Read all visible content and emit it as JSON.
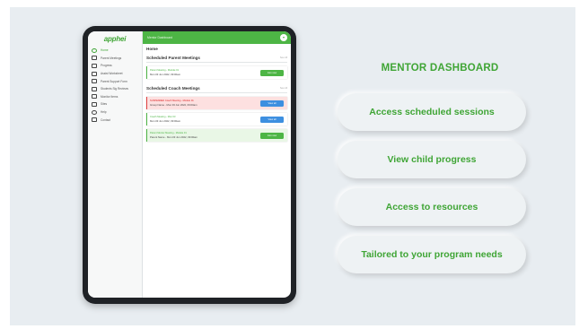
{
  "logo": "apphei",
  "sidebar": {
    "items": [
      {
        "label": "Home",
        "active": true
      },
      {
        "label": "Parent Meetings"
      },
      {
        "label": "Progress"
      },
      {
        "label": "Assist Worksheet"
      },
      {
        "label": "Parent Support Form"
      },
      {
        "label": "Students Sig Reviews"
      },
      {
        "label": "Monitor Items"
      },
      {
        "label": "Sites"
      },
      {
        "label": "Help"
      },
      {
        "label": "Contact"
      }
    ]
  },
  "topbar": {
    "label": "Mentor Dashboard",
    "menu_icon": "chevron-down-icon"
  },
  "main": {
    "title": "Home",
    "parent_section": {
      "title": "Scheduled Parent Meetings",
      "see_all": "See All",
      "cards": [
        {
          "line1": "Parent Meeting - Module 01",
          "line2": "Mon 03 Jun 2022, 09:00am",
          "button": "Join now",
          "button_color": "green",
          "style": "plain"
        }
      ]
    },
    "coach_section": {
      "title": "Scheduled Coach Meetings",
      "see_all": "See All",
      "cards": [
        {
          "line1": "SUSPENDED Coach Meeting - Module 01",
          "line2": "Group Name - Mon 03 Jun 2022, 09:00am",
          "button": "View all",
          "button_color": "blue",
          "style": "alert"
        },
        {
          "line1": "Coach Meeting - Mon 03",
          "line2": "Mon 03 Jun 2022, 09:00am",
          "button": "View all",
          "button_color": "blue",
          "style": "plain"
        },
        {
          "line1": "Parent Mentor Meeting - Module 01",
          "line2": "Parent Name - Mon 03 Jun 2022, 09:00am",
          "button": "Join now",
          "button_color": "green",
          "style": "tint"
        }
      ]
    }
  },
  "dashboard": {
    "title": "MENTOR DASHBOARD",
    "features": [
      "Access scheduled sessions",
      "View child progress",
      "Access to resources",
      "Tailored to your program needs"
    ]
  },
  "colors": {
    "brand_green": "#3fa535",
    "alert_red": "#e04141",
    "action_blue": "#3d8fe0"
  }
}
